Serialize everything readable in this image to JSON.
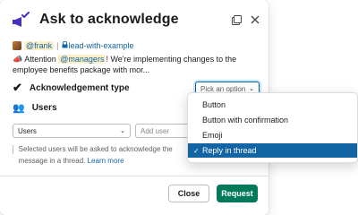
{
  "modal": {
    "title": "Ask to acknowledge",
    "icons": {
      "app": "megaphone-check-icon",
      "popout": "popout-icon",
      "close": "close-icon"
    }
  },
  "message": {
    "author": "@frank",
    "separator": "|",
    "channel": "lead-with-example",
    "emoji": "megaphone-icon",
    "preview_prefix": "Attention",
    "preview_mention": "@managers",
    "preview_text": "! We're implementing changes to the employee benefits package with mor..."
  },
  "acknowledgement": {
    "label": "Acknowledgement type",
    "select_placeholder": "Pick an option",
    "options": [
      {
        "label": "Button",
        "selected": false
      },
      {
        "label": "Button with confirmation",
        "selected": false
      },
      {
        "label": "Emoji",
        "selected": false
      },
      {
        "label": "Reply in thread",
        "selected": true
      }
    ]
  },
  "users": {
    "label": "Users",
    "select_value": "Users",
    "add_user_placeholder": "Add user",
    "hint_text": "Selected users will be asked to acknowledge the message in a thread.",
    "hint_link": "Learn more"
  },
  "footer": {
    "close_label": "Close",
    "request_label": "Request"
  },
  "colors": {
    "accent": "#1264a3",
    "primary_button": "#007a5a",
    "mention_bg": "#fcefc8"
  }
}
